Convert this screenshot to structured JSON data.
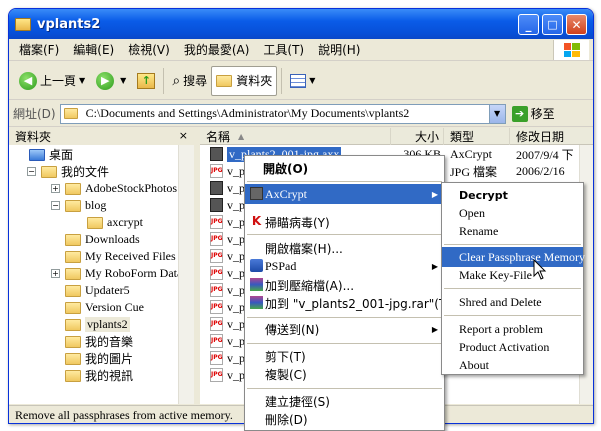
{
  "window": {
    "title": "vplants2",
    "controls": {
      "minimize": "_",
      "maximize": "□",
      "close": "✕"
    }
  },
  "menubar": [
    "檔案(F)",
    "編輯(E)",
    "檢視(V)",
    "我的最愛(A)",
    "工具(T)",
    "說明(H)"
  ],
  "toolbar": {
    "back": "上一頁",
    "search": "搜尋",
    "folders": "資料夾"
  },
  "address": {
    "label": "網址(D)",
    "value": "C:\\Documents and Settings\\Administrator\\My Documents\\vplants2",
    "go": "移至"
  },
  "folders_pane": {
    "title": "資料夾",
    "close": "×",
    "tree": [
      {
        "label": "桌面",
        "level": 0,
        "exp": ""
      },
      {
        "label": "我的文件",
        "level": 1,
        "exp": "−"
      },
      {
        "label": "AdobeStockPhotos",
        "level": 2,
        "exp": "+"
      },
      {
        "label": "blog",
        "level": 2,
        "exp": "−"
      },
      {
        "label": "axcrypt",
        "level": 3,
        "exp": ""
      },
      {
        "label": "Downloads",
        "level": 2,
        "exp": ""
      },
      {
        "label": "My Received Files",
        "level": 2,
        "exp": ""
      },
      {
        "label": "My RoboForm Data",
        "level": 2,
        "exp": "+"
      },
      {
        "label": "Updater5",
        "level": 2,
        "exp": ""
      },
      {
        "label": "Version Cue",
        "level": 2,
        "exp": ""
      },
      {
        "label": "vplants2",
        "level": 2,
        "exp": "",
        "selected": true
      },
      {
        "label": "我的音樂",
        "level": 2,
        "exp": ""
      },
      {
        "label": "我的圖片",
        "level": 2,
        "exp": ""
      },
      {
        "label": "我的視訊",
        "level": 2,
        "exp": ""
      }
    ]
  },
  "files": {
    "columns": {
      "name": "名稱",
      "size": "大小",
      "type": "類型",
      "date": "修改日期"
    },
    "rows": [
      {
        "name": "v_plants2_001-jpg.axx",
        "size": "306 KB",
        "type": "AxCrypt",
        "date": "2007/9/4 下",
        "icon": "axx",
        "selected": true
      },
      {
        "name": "v_pla",
        "size": "",
        "type": "JPG 檔案",
        "date": "2006/2/16",
        "icon": "JPG"
      },
      {
        "name": "v_pla",
        "size": "",
        "type": "",
        "date": "",
        "icon": "axx"
      },
      {
        "name": "v_pla",
        "size": "",
        "type": "",
        "date": "",
        "icon": "axx"
      },
      {
        "name": "v_pla",
        "size": "",
        "type": "",
        "date": "",
        "icon": "JPG"
      },
      {
        "name": "v_pla",
        "size": "",
        "type": "",
        "date": "",
        "icon": "JPG"
      },
      {
        "name": "v_pla",
        "size": "",
        "type": "",
        "date": "",
        "icon": "JPG"
      },
      {
        "name": "v_pla",
        "size": "",
        "type": "",
        "date": "",
        "icon": "JPG"
      },
      {
        "name": "v_pla",
        "size": "",
        "type": "",
        "date": "",
        "icon": "JPG"
      },
      {
        "name": "v_pla",
        "size": "",
        "type": "",
        "date": "",
        "icon": "JPG"
      },
      {
        "name": "v_pla",
        "size": "",
        "type": "",
        "date": "",
        "icon": "JPG"
      },
      {
        "name": "v_pla",
        "size": "",
        "type": "",
        "date": "",
        "icon": "JPG"
      },
      {
        "name": "v_pla",
        "size": "",
        "type": "",
        "date": "",
        "icon": "JPG"
      },
      {
        "name": "v_pla",
        "size": "",
        "type": "",
        "date": "",
        "icon": "JPG"
      }
    ]
  },
  "context_menu": {
    "open": "開啟(O)",
    "axcrypt": "AxCrypt",
    "scan": "掃瞄病毒(Y)",
    "open_with": "開啟檔案(H)...",
    "pspad": "PSPad",
    "add_archive": "加到壓縮檔(A)...",
    "add_rar": "加到 \"v_plants2_001-jpg.rar\"(T)",
    "send_to": "傳送到(N)",
    "cut": "剪下(T)",
    "copy": "複製(C)",
    "shortcut": "建立捷徑(S)",
    "delete": "刪除(D)"
  },
  "submenu": {
    "decrypt": "Decrypt",
    "open": "Open",
    "rename": "Rename",
    "clear_passphrase": "Clear Passphrase Memory",
    "make_keyfile": "Make Key-File",
    "shred": "Shred and Delete",
    "report": "Report a problem",
    "activation": "Product Activation",
    "about": "About"
  },
  "status": {
    "text": "Remove all passphrases from active memory."
  },
  "colors": {
    "titlebar": "#0a5ce8",
    "highlight": "#316ac5",
    "chrome": "#ece9d8"
  }
}
